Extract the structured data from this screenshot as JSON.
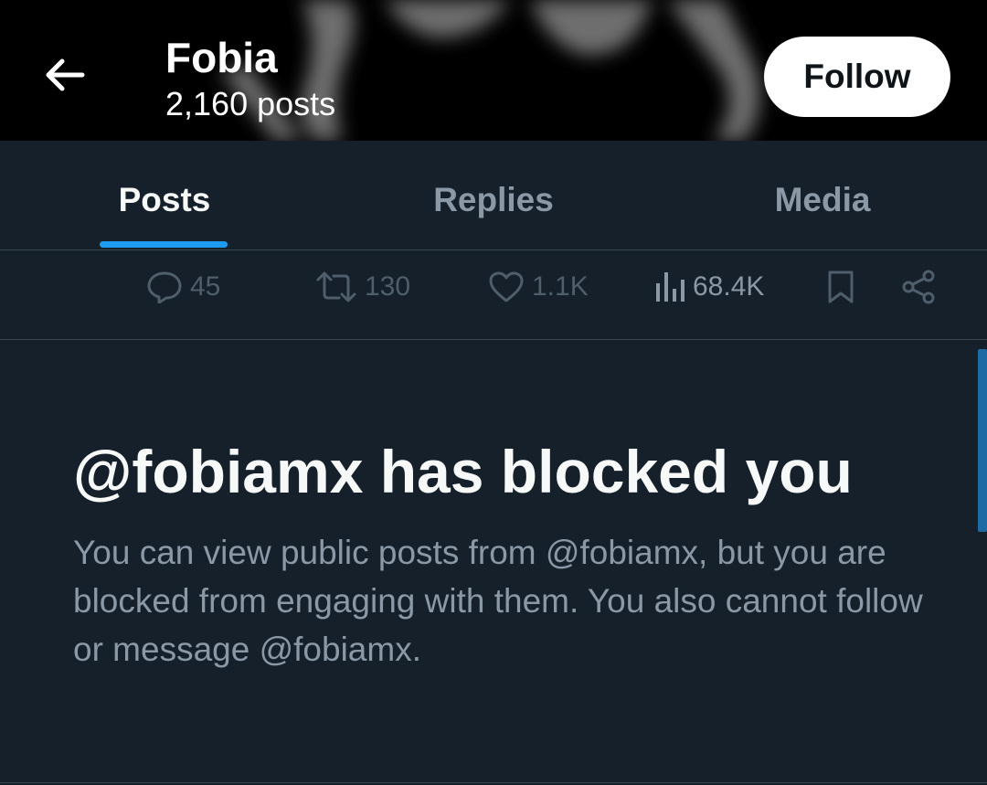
{
  "header": {
    "profile_name": "Fobia",
    "post_count": "2,160 posts",
    "follow_label": "Follow"
  },
  "tabs": [
    {
      "label": "Posts",
      "active": true
    },
    {
      "label": "Replies",
      "active": false
    },
    {
      "label": "Media",
      "active": false
    }
  ],
  "actions": {
    "replies": "45",
    "reposts": "130",
    "likes": "1.1K",
    "views": "68.4K"
  },
  "blocked": {
    "title": "@fobiamx has blocked you",
    "description": "You can view public posts from @fobiamx, but you are blocked from engaging with them. You also cannot follow or message @fobiamx."
  },
  "colors": {
    "background": "#15202b",
    "accent": "#1d9bf0",
    "muted_text": "#8b98a5",
    "divider": "#38444d"
  },
  "icons": [
    "back-arrow-icon",
    "reply-icon",
    "repost-icon",
    "like-icon",
    "views-icon",
    "bookmark-icon",
    "share-icon"
  ]
}
